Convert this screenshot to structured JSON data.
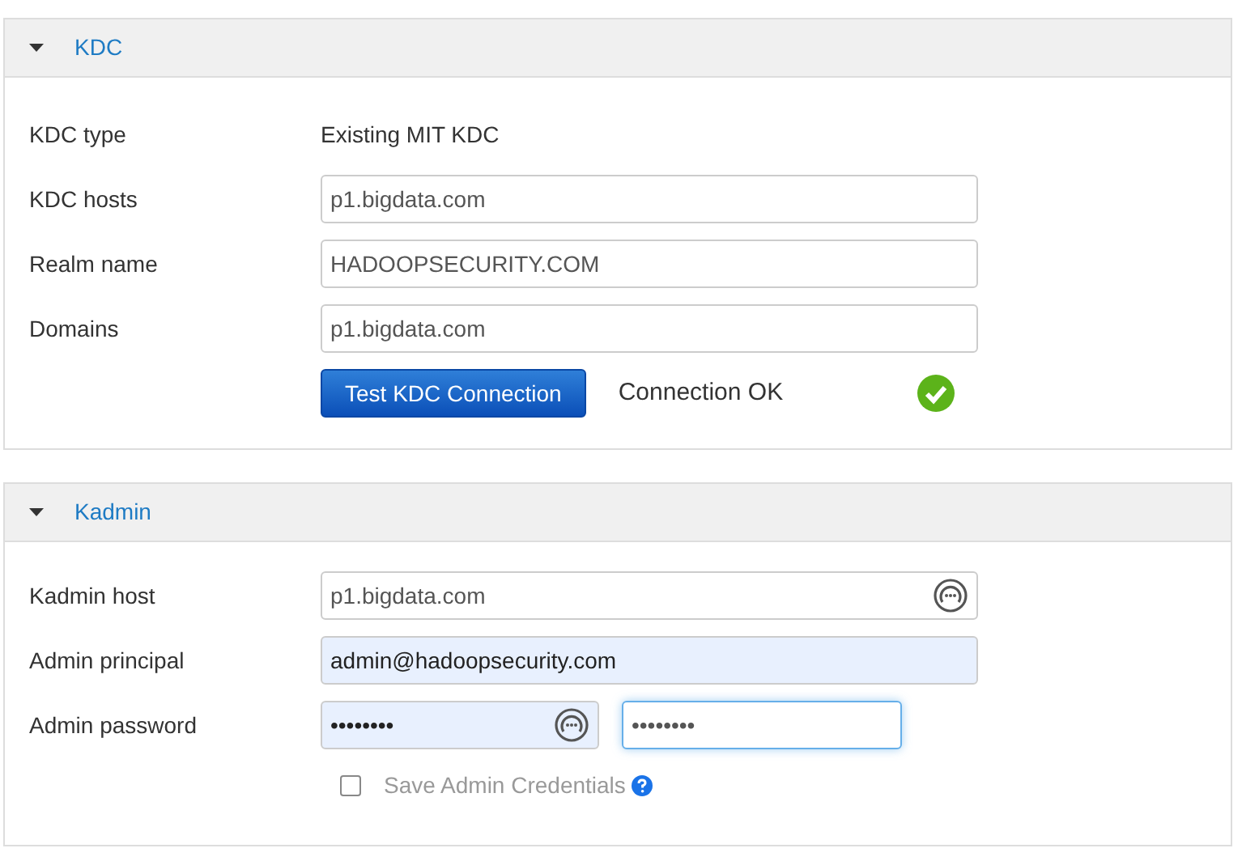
{
  "sections": [
    {
      "title": "KDC",
      "expanded": true,
      "rows": [
        {
          "kind": "text",
          "label": "KDC type",
          "value": "Existing MIT KDC"
        },
        {
          "kind": "input",
          "label": "KDC hosts",
          "value": "p1.bigdata.com",
          "autofilled": false,
          "key_icon": false
        },
        {
          "kind": "input",
          "label": "Realm name",
          "value": "HADOOPSECURITY.COM",
          "autofilled": false,
          "key_icon": false
        },
        {
          "kind": "input",
          "label": "Domains",
          "value": "p1.bigdata.com",
          "autofilled": false,
          "key_icon": false
        },
        {
          "kind": "test",
          "button": "Test KDC Connection",
          "status": "Connection OK",
          "ok": true
        }
      ]
    },
    {
      "title": "Kadmin",
      "expanded": true,
      "rows": [
        {
          "kind": "input",
          "label": "Kadmin host",
          "value": "p1.bigdata.com",
          "autofilled": false,
          "key_icon": true
        },
        {
          "kind": "input",
          "label": "Admin principal",
          "value": "admin@hadoopsecurity.com",
          "autofilled": true,
          "key_icon": false
        },
        {
          "kind": "password",
          "label": "Admin password",
          "fields": [
            {
              "value": "••••••••",
              "autofilled": true,
              "key_icon": true,
              "focused": false
            },
            {
              "value": "••••••••",
              "autofilled": false,
              "key_icon": false,
              "focused": true
            }
          ]
        },
        {
          "kind": "checkbox",
          "label": "Save Admin Credentials",
          "checked": false,
          "help": true
        }
      ]
    }
  ]
}
